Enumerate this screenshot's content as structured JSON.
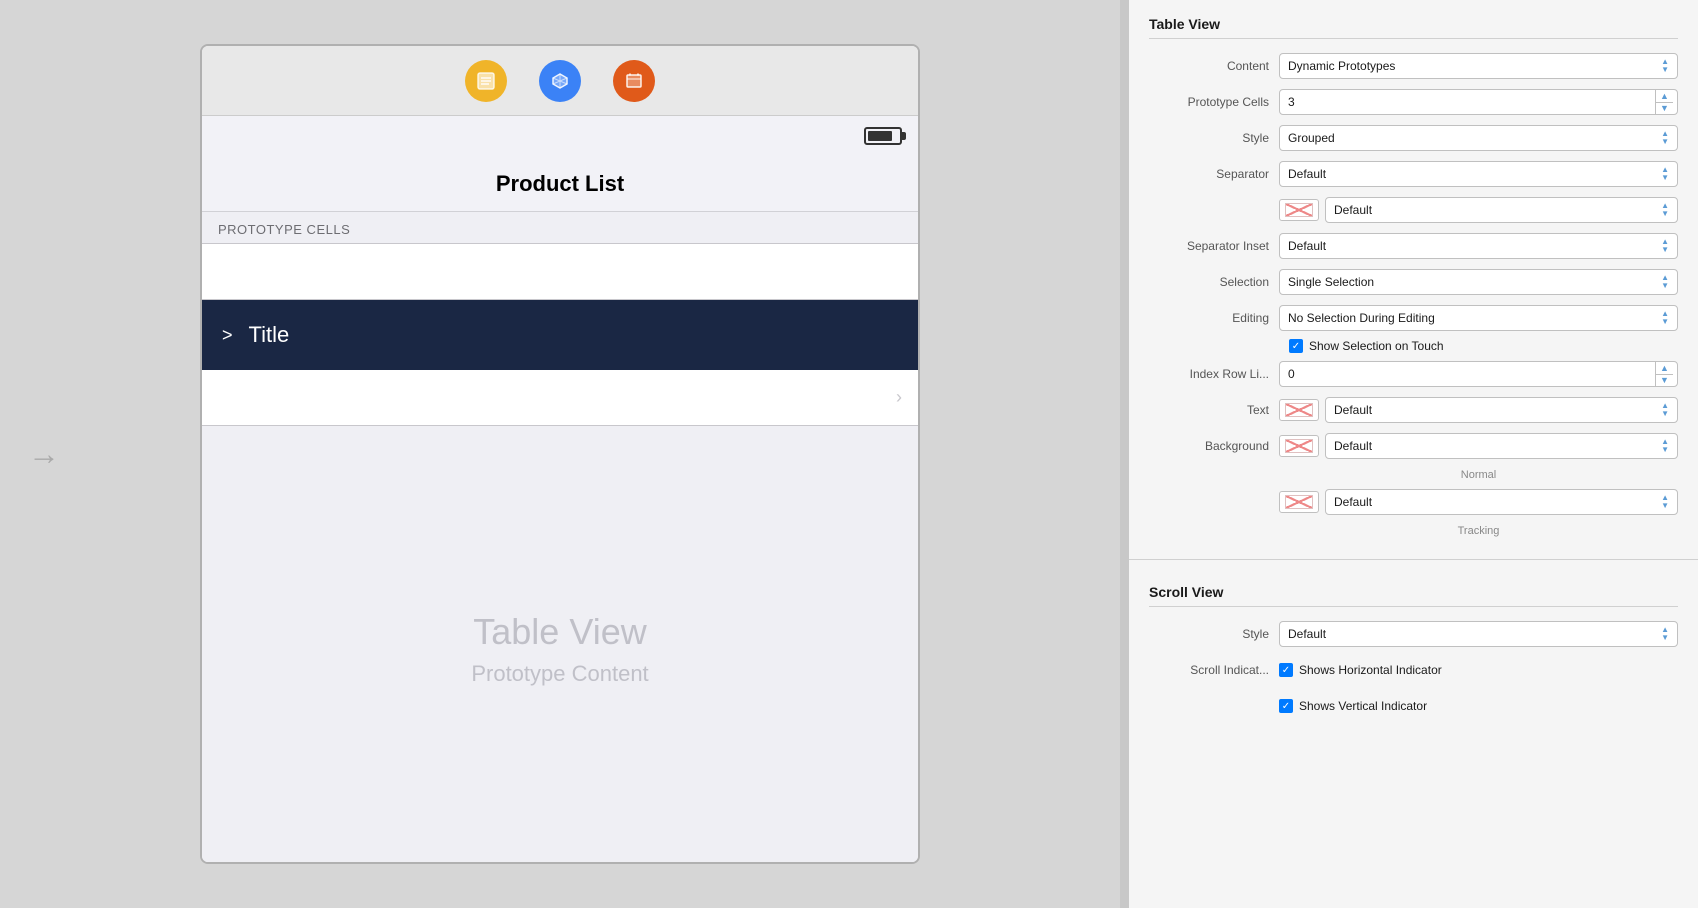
{
  "canvas": {
    "arrow_label": "→",
    "iphone": {
      "title": "Product List",
      "section_header": "PROTOTYPE CELLS",
      "cell_title": "Title",
      "cell_chevron": ">",
      "placeholder_title": "Table View",
      "placeholder_subtitle": "Prototype Content"
    }
  },
  "inspector": {
    "table_view_section": "Table View",
    "scroll_view_section": "Scroll View",
    "properties": {
      "content_label": "Content",
      "content_value": "Dynamic Prototypes",
      "prototype_cells_label": "Prototype Cells",
      "prototype_cells_value": "3",
      "style_label": "Style",
      "style_value": "Grouped",
      "separator_label": "Separator",
      "separator_value": "Default",
      "separator_color_value": "Default",
      "separator_inset_label": "Separator Inset",
      "separator_inset_value": "Default",
      "selection_label": "Selection",
      "selection_value": "Single Selection",
      "editing_label": "Editing",
      "editing_value": "No Selection During Editing",
      "show_selection_label": "Show Selection on Touch",
      "index_row_label": "Index Row Li...",
      "index_row_value": "0",
      "text_label": "Text",
      "text_value": "Default",
      "background_label": "Background",
      "background_value": "Default",
      "normal_label": "Normal",
      "tracking_label": "Tracking",
      "default_tracking_value": "Default",
      "scroll_style_label": "Style",
      "scroll_style_value": "Default",
      "scroll_indicators_label": "Scroll Indicat...",
      "shows_horizontal_label": "Shows Horizontal Indicator",
      "shows_vertical_label": "Shows Vertical Indicator"
    },
    "stepper_up": "▲",
    "stepper_down": "▼",
    "select_up": "▲",
    "select_down": "▼"
  }
}
